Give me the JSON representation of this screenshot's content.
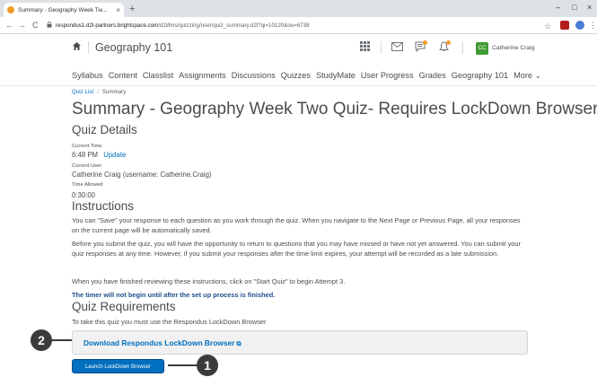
{
  "browser": {
    "tab_title": "Summary - Geography Week Tw...",
    "tab_close": "×",
    "new_tab": "+",
    "win_min": "–",
    "win_max": "□",
    "win_close": "×",
    "back": "←",
    "forward": "→",
    "reload": "C",
    "url_host": "respondus1.d2l-partners.brightspace.com",
    "url_path": "/d2l/lms/quizzing/user/quiz_summary.d2l?qi=10120&ou=6738",
    "star": "☆"
  },
  "topbar": {
    "course_title": "Geography 101",
    "avatar_initials": "CC",
    "user_name": "Catherine Craig"
  },
  "nav": {
    "items": [
      "Syllabus",
      "Content",
      "Classlist",
      "Assignments",
      "Discussions",
      "Quizzes",
      "StudyMate",
      "User Progress",
      "Grades",
      "Geography 101",
      "More ⌄"
    ]
  },
  "breadcrumb": {
    "parent": "Quiz List",
    "separator": "/",
    "current": "Summary"
  },
  "page_title": "Summary - Geography Week Two Quiz- Requires LockDown Browser",
  "details": {
    "heading": "Quiz Details",
    "current_time_label": "Current Time",
    "current_time": "6:48 PM",
    "update_link": "Update",
    "current_user_label": "Current User",
    "current_user": "Catherine Craig (username: Catherine.Craig)",
    "time_allowed_label": "Time Allowed",
    "time_allowed": "0:30:00"
  },
  "instructions": {
    "heading": "Instructions",
    "p1": "You can \"Save\" your response to each question as you work through the quiz. When you navigate to the Next Page or Previous Page, all your responses on the current page will be automatically saved.",
    "p2": "Before you submit the quiz, you will have the opportunity to return to questions that you may have missed or have not yet answered. You can submit your quiz responses at any time. However, if you submit your responses after the time limit expires, your attempt will be recorded as a late submission.",
    "p3": "When you have finished reviewing these instructions, click on \"Start Quiz\" to begin Attempt 3.",
    "timer_note": "The timer will not begin until after the set up process is finished."
  },
  "requirements": {
    "heading": "Quiz Requirements",
    "text": "To take this quiz you must use the Respondus LockDown Browser",
    "download_link": "Download Respondus LockDown Browser",
    "launch_button": "Launch LockDown Browser"
  },
  "callouts": {
    "one": "1",
    "two": "2"
  },
  "colors": {
    "link": "#006fbf",
    "button": "#006fbf",
    "avatar": "#3f9c35",
    "notification_dot": "#f29b29",
    "callout": "#3b3b3b"
  }
}
